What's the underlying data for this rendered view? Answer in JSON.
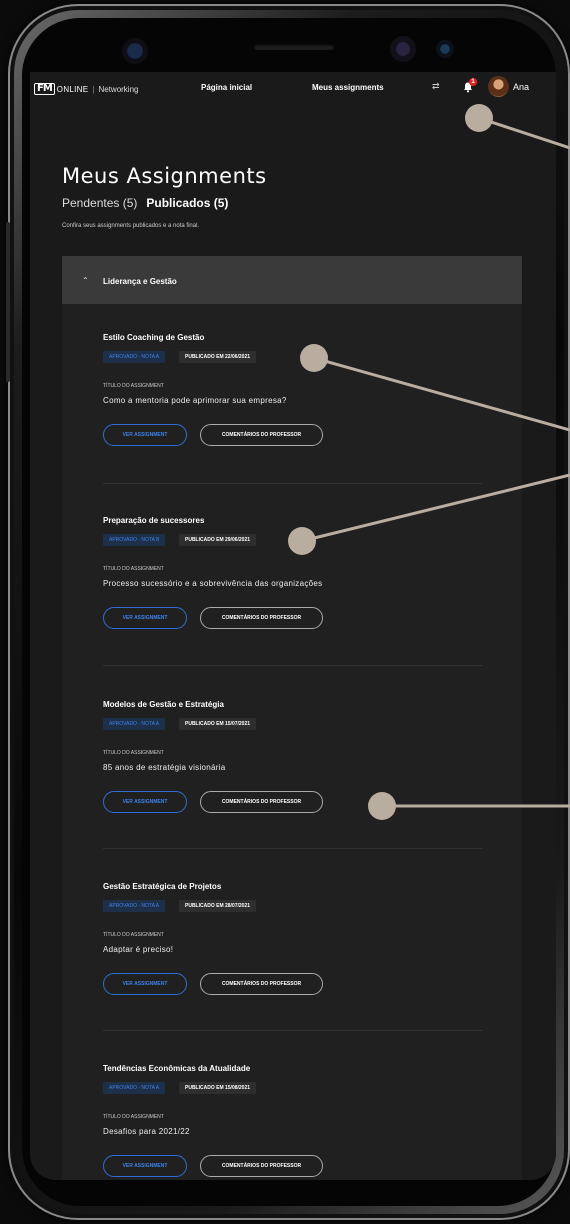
{
  "nav": {
    "logo_mark": "FM",
    "logo_online": "ONLINE",
    "logo_section": "Networking",
    "home_link": "Página inicial",
    "assignments_link": "Meus assignments",
    "notification_count": "1",
    "user_name": "Ana"
  },
  "page": {
    "title": "Meus Assignments",
    "tab_pending": "Pendentes (5)",
    "tab_published": "Publicados (5)",
    "description": "Confira seus assignments publicados e a nota final."
  },
  "section": {
    "title": "Liderança e Gestão"
  },
  "cards": [
    {
      "title": "Estilo Coaching de Gestão",
      "grade": "APROVADO - NOTA A",
      "date": "PUBLICADO EM 22/06/2021",
      "label": "TÍTULO DO ASSIGNMENT",
      "assignment": "Como a mentoria pode aprimorar sua empresa?",
      "view_label": "VER ASSIGNMENT",
      "comment_label": "COMENTÁRIOS DO PROFESSOR"
    },
    {
      "title": "Preparação de sucessores",
      "grade": "APROVADO - NOTA B",
      "date": "PUBLICADO EM 29/06/2021",
      "label": "TÍTULO DO ASSIGNMENT",
      "assignment": "Processo sucessório e a sobrevivência das organizações",
      "view_label": "VER ASSIGNMENT",
      "comment_label": "COMENTÁRIOS DO PROFESSOR"
    },
    {
      "title": "Modelos de Gestão e Estratégia",
      "grade": "APROVADO - NOTA A",
      "date": "PUBLICADO EM 15/07/2021",
      "label": "TÍTULO DO ASSIGNMENT",
      "assignment": "85 anos de estratégia visionária",
      "view_label": "VER ASSIGNMENT",
      "comment_label": "COMENTÁRIOS DO PROFESSOR"
    },
    {
      "title": "Gestão Estratégica de Projetos",
      "grade": "APROVADO - NOTA A",
      "date": "PUBLICADO EM 28/07/2021",
      "label": "TÍTULO DO ASSIGNMENT",
      "assignment": "Adaptar é preciso!",
      "view_label": "VER ASSIGNMENT",
      "comment_label": "COMENTÁRIOS DO PROFESSOR"
    },
    {
      "title": "Tendências Econômicas da Atualidade",
      "grade": "APROVADO - NOTA A",
      "date": "PUBLICADO EM 15/08/2021",
      "label": "TÍTULO DO ASSIGNMENT",
      "assignment": "Desafios para 2021/22",
      "view_label": "VER ASSIGNMENT",
      "comment_label": "COMENTÁRIOS DO PROFESSOR"
    }
  ],
  "colors": {
    "background": "#1a1a1a",
    "section_header": "#3a3a3a",
    "accent_blue": "#3e82e8",
    "badge_grade_bg": "#1e2f4a",
    "notification_red": "#e02424",
    "callout": "#b9ada0"
  },
  "icons": {
    "swap": "swap-arrows-icon",
    "bell": "bell-icon",
    "chevron": "chevron-up-icon"
  }
}
